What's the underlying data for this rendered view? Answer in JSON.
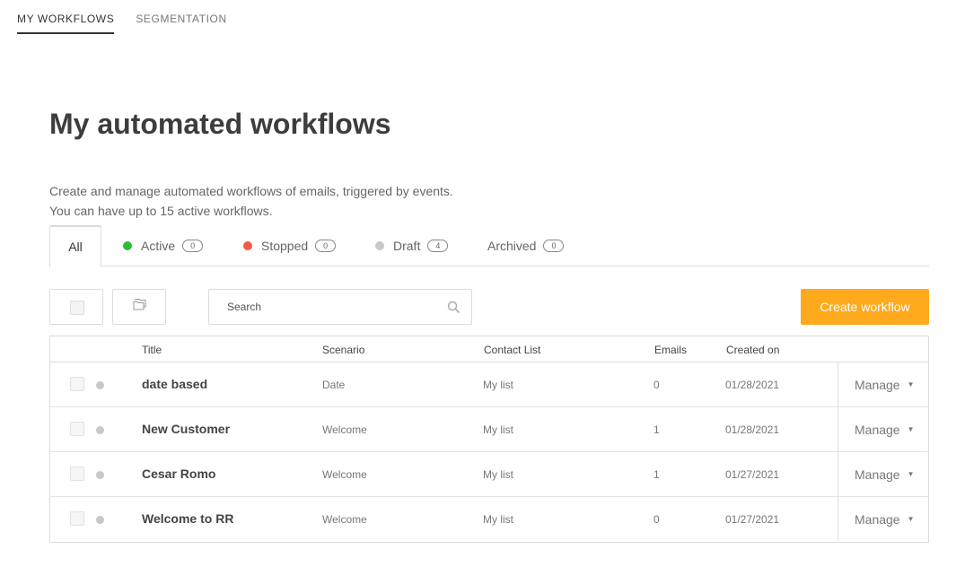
{
  "top_nav": [
    {
      "label": "MY WORKFLOWS",
      "active": true
    },
    {
      "label": "SEGMENTATION",
      "active": false
    }
  ],
  "page": {
    "title": "My automated workflows",
    "description_line1": "Create and manage automated workflows of emails, triggered by events.",
    "description_line2": "You can have up to 15 active workflows."
  },
  "filter_tabs": [
    {
      "label": "All",
      "count": null,
      "dot_color": null
    },
    {
      "label": "Active",
      "count": "0",
      "dot_color": "#2dbb3a"
    },
    {
      "label": "Stopped",
      "count": "0",
      "dot_color": "#f25a45"
    },
    {
      "label": "Draft",
      "count": "4",
      "dot_color": "#c8c8c8"
    },
    {
      "label": "Archived",
      "count": "0",
      "dot_color": null
    }
  ],
  "toolbar": {
    "search_placeholder": "Search",
    "create_label": "Create workflow",
    "accent_color": "#ffa91c"
  },
  "table": {
    "columns": {
      "title": "Title",
      "scenario": "Scenario",
      "contact_list": "Contact List",
      "emails": "Emails",
      "created_on": "Created on"
    },
    "manage_label": "Manage",
    "rows": [
      {
        "title": "date based",
        "scenario": "Date",
        "contact_list": "My list",
        "emails": "0",
        "created_on": "01/28/2021"
      },
      {
        "title": "New Customer",
        "scenario": "Welcome",
        "contact_list": "My list",
        "emails": "1",
        "created_on": "01/28/2021"
      },
      {
        "title": "Cesar Romo",
        "scenario": "Welcome",
        "contact_list": "My list",
        "emails": "1",
        "created_on": "01/27/2021"
      },
      {
        "title": "Welcome to RR",
        "scenario": "Welcome",
        "contact_list": "My list",
        "emails": "0",
        "created_on": "01/27/2021"
      }
    ]
  }
}
